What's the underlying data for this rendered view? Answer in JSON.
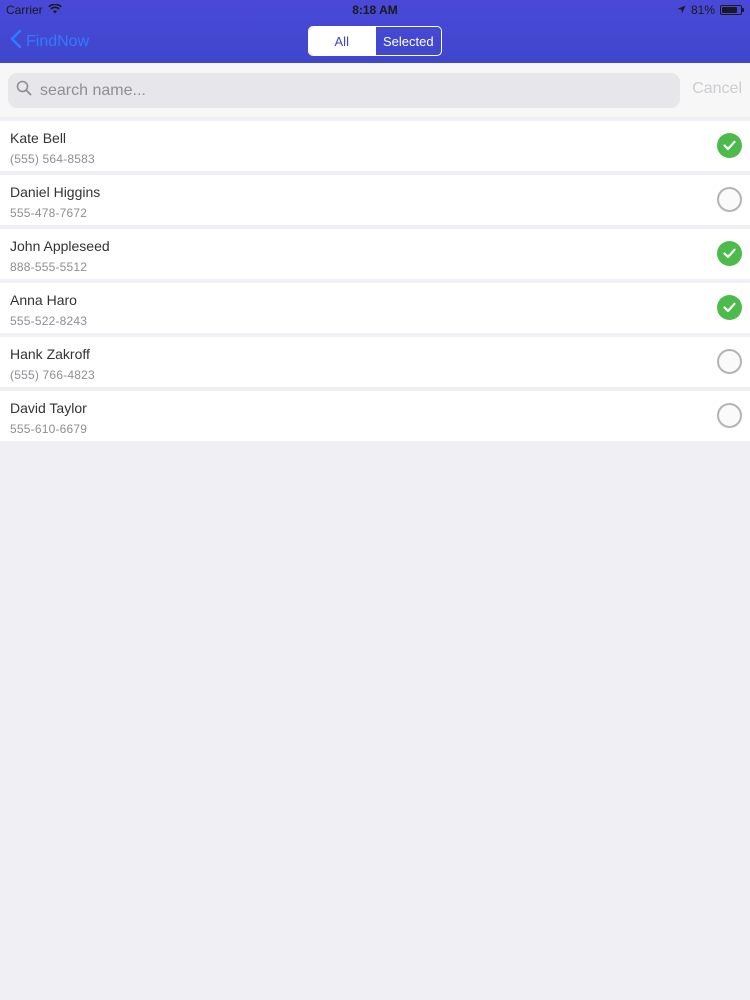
{
  "status_bar": {
    "carrier": "Carrier",
    "time": "8:18 AM",
    "battery": "81%",
    "battery_level": 0.81
  },
  "nav": {
    "back_label": "FindNow",
    "segments": [
      {
        "label": "All",
        "active": true
      },
      {
        "label": "Selected",
        "active": false
      }
    ]
  },
  "search": {
    "placeholder": "search name...",
    "cancel_label": "Cancel"
  },
  "contacts": [
    {
      "name": "Kate Bell",
      "phone": "(555) 564-8583",
      "selected": true
    },
    {
      "name": "Daniel Higgins",
      "phone": "555-478-7672",
      "selected": false
    },
    {
      "name": "John Appleseed",
      "phone": "888-555-5512",
      "selected": true
    },
    {
      "name": "Anna Haro",
      "phone": "555-522-8243",
      "selected": true
    },
    {
      "name": "Hank Zakroff",
      "phone": "(555) 766-4823",
      "selected": false
    },
    {
      "name": "David Taylor",
      "phone": "555-610-6679",
      "selected": false
    }
  ],
  "colors": {
    "header": "#3f47cc",
    "accent": "#2f7bff",
    "selected": "#4cbb4c"
  }
}
